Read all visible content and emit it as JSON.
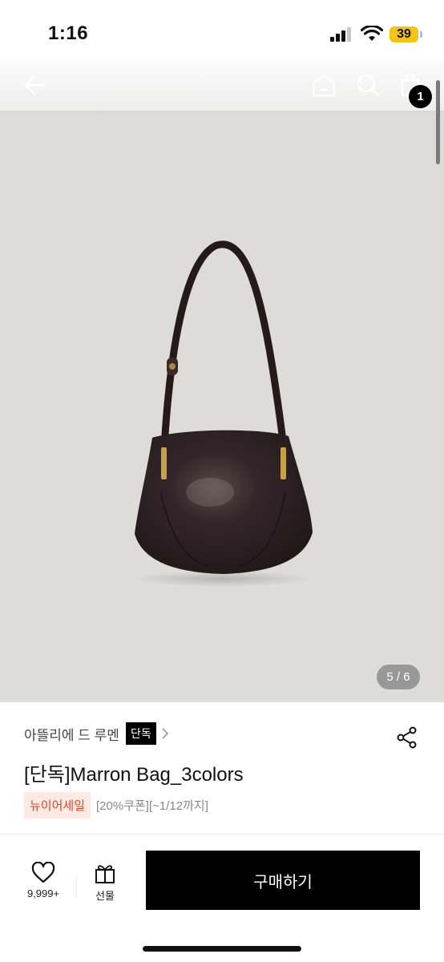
{
  "status": {
    "time": "1:16",
    "battery": "39"
  },
  "nav": {
    "cart_count": "1"
  },
  "gallery": {
    "counter": "5 / 6"
  },
  "product": {
    "brand": "아뜰리에 드 루멘",
    "exclusive_tag": "단독",
    "title": "[단독]Marron Bag_3colors",
    "sale_badge": "뉴이어세일",
    "coupon_text": "[20%쿠폰][~1/12까지]"
  },
  "actions": {
    "wish_count": "9,999+",
    "gift_label": "선물",
    "buy_label": "구매하기"
  },
  "colors": {
    "sale_text": "#e0451e",
    "sale_bg": "#fde9e4",
    "bag": "#2a1f1e",
    "hardware": "#c9a04a"
  }
}
